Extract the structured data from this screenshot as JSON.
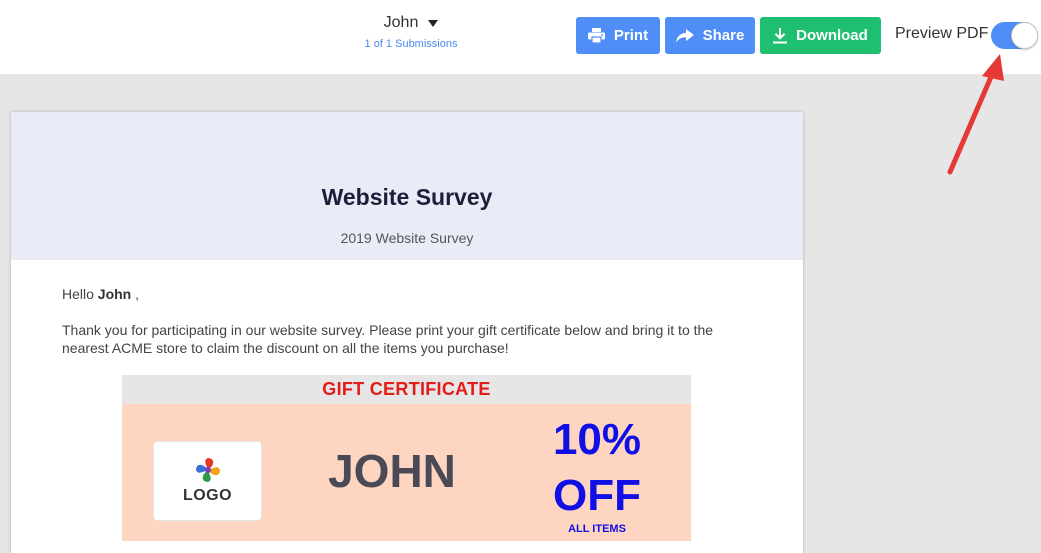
{
  "submission": {
    "name": "John",
    "count_text": "1 of 1 Submissions"
  },
  "toolbar": {
    "print_label": "Print",
    "share_label": "Share",
    "download_label": "Download",
    "preview_label": "Preview PDF",
    "preview_enabled": true
  },
  "colors": {
    "primary_button": "#4f8ef7",
    "download_button": "#1fbf72",
    "annotation_arrow": "#e53935"
  },
  "document": {
    "title": "Website Survey",
    "subtitle": "2019 Website Survey",
    "greeting_prefix": "Hello ",
    "greeting_name": "John",
    "greeting_suffix": " ,",
    "message": "Thank you for participating in our website survey. Please print your gift certificate below and bring it to the nearest ACME store to claim the discount on all the items you purchase!",
    "certificate": {
      "heading": "GIFT CERTIFICATE",
      "logo_text": "LOGO",
      "name": "JOHN",
      "discount_percent": "10%",
      "discount_off": "OFF",
      "scope": "ALL ITEMS"
    }
  },
  "icons": {
    "print": "printer-icon",
    "share": "share-arrow-icon",
    "download": "download-icon",
    "dropdown": "caret-down-icon",
    "logo": "logo-mark-icon"
  }
}
